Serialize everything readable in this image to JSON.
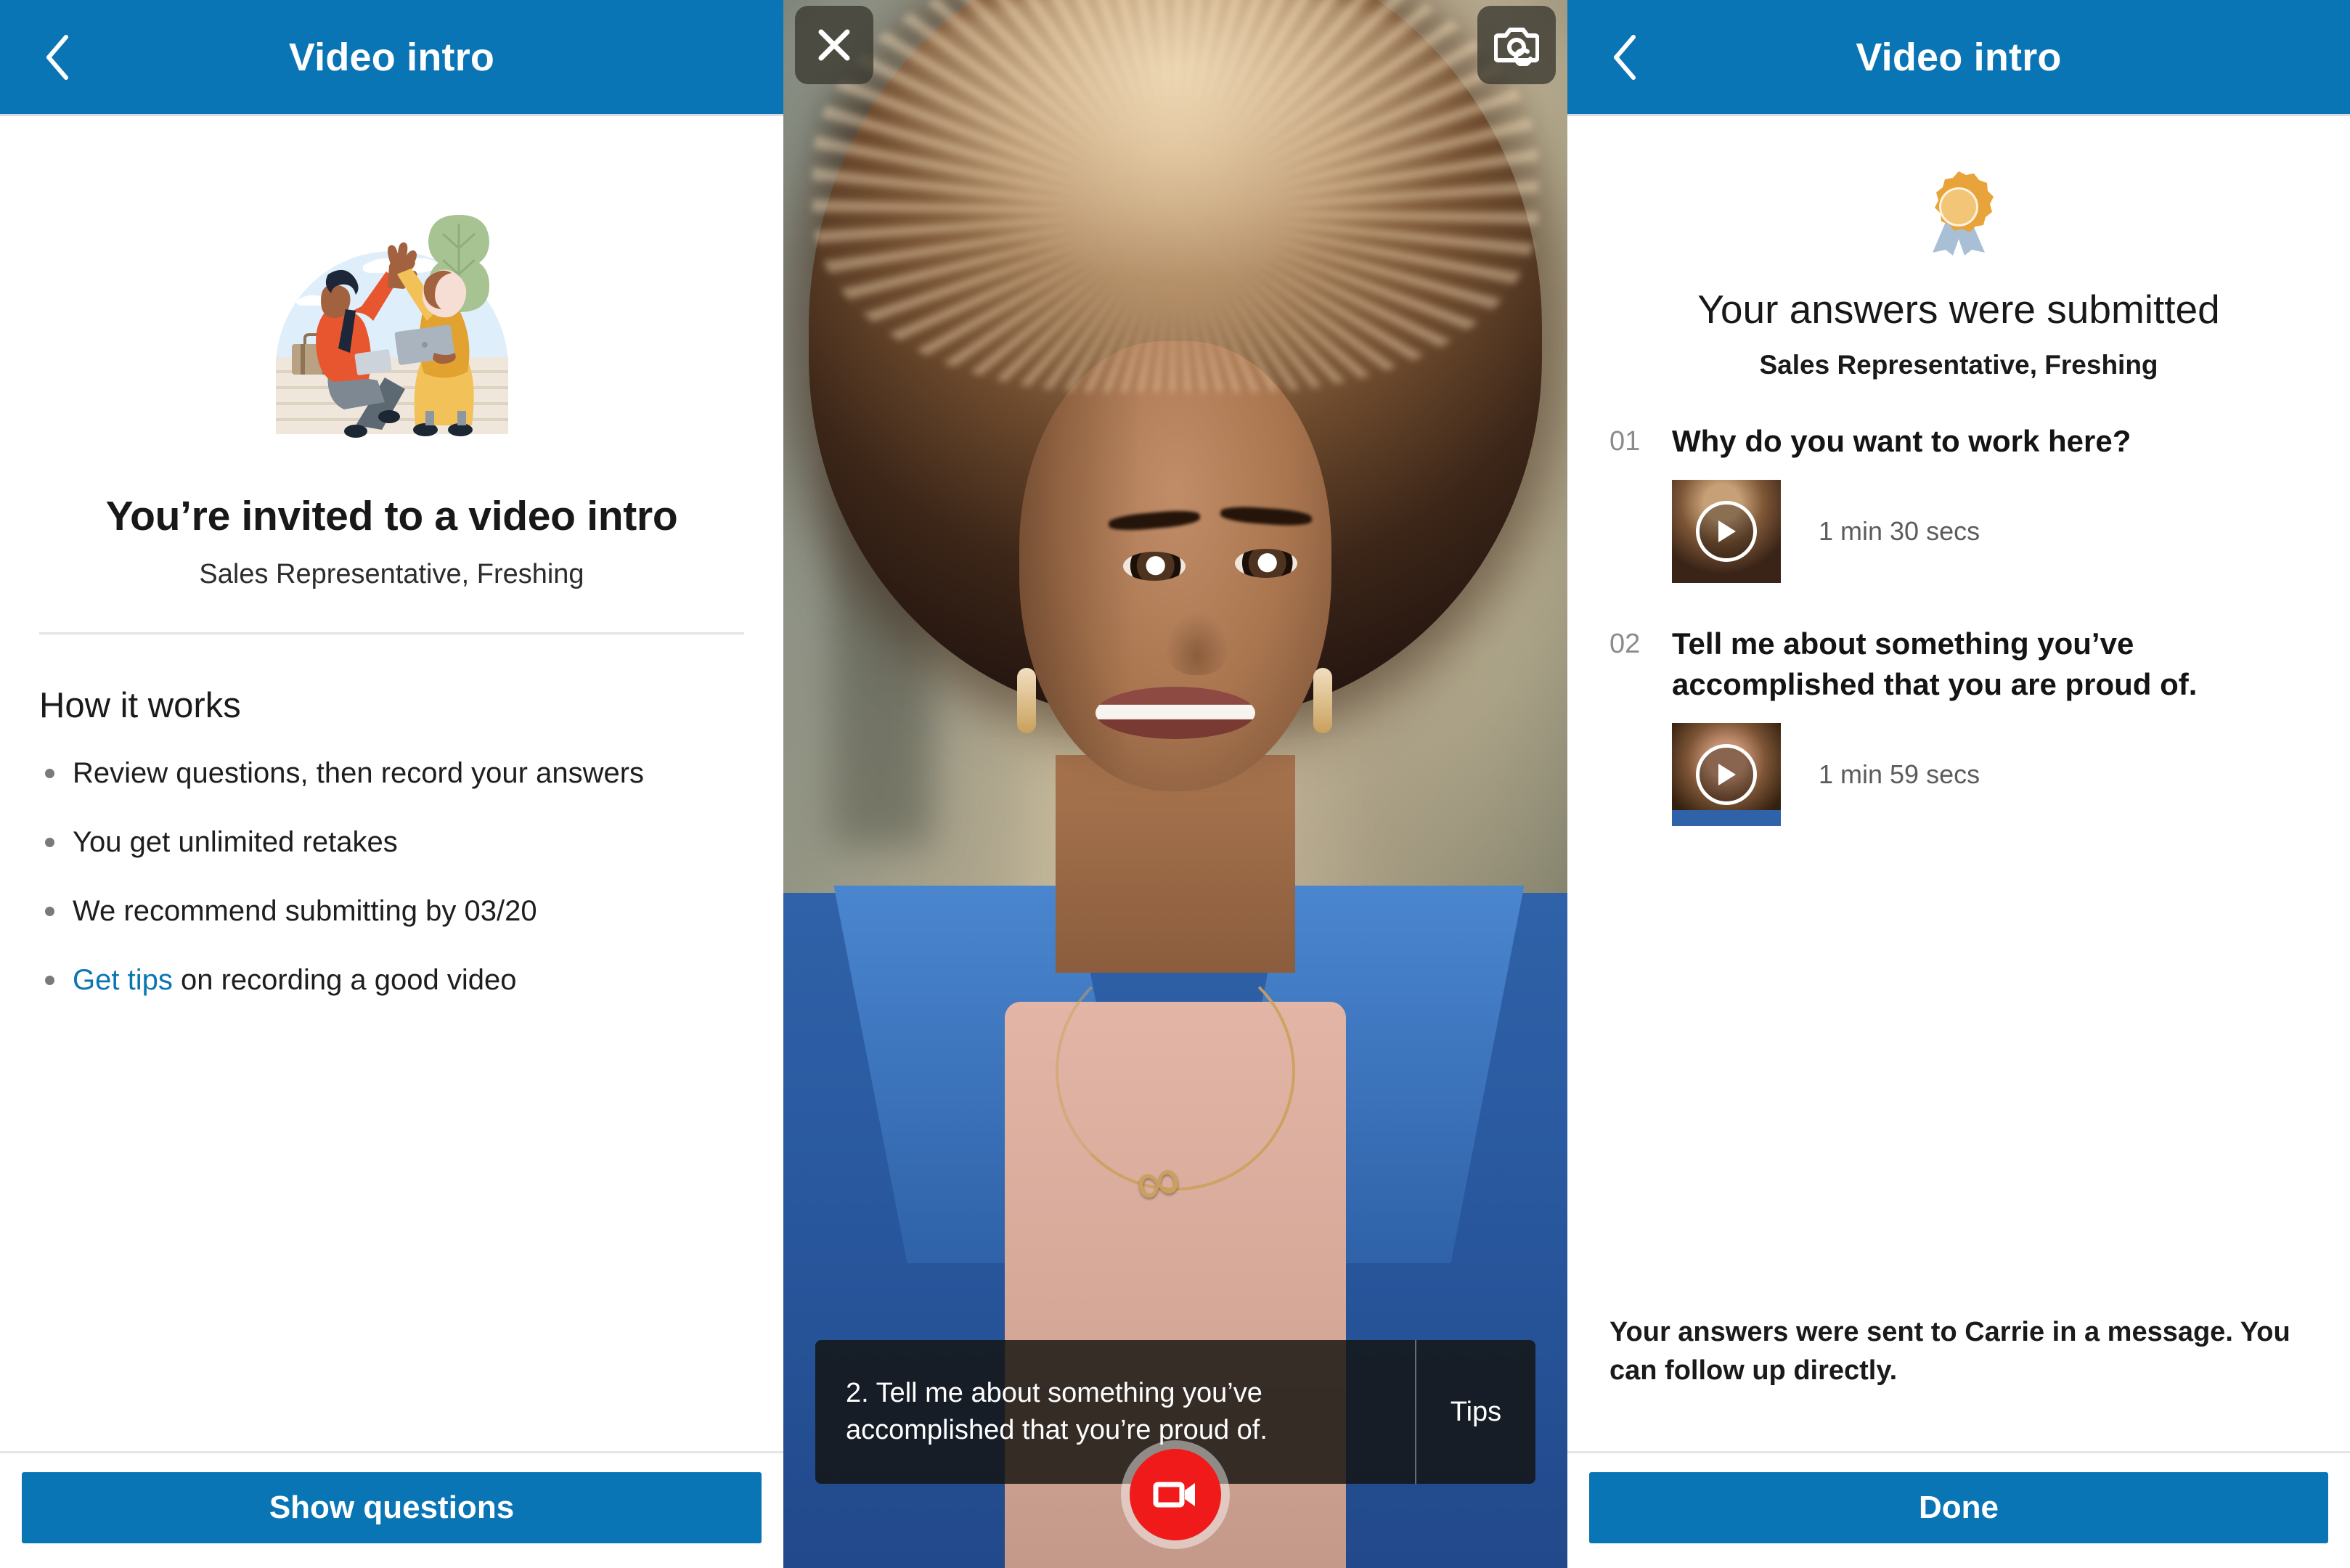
{
  "panel_invite": {
    "navbar": {
      "title": "Video intro",
      "back_icon": "chevron-left-icon"
    },
    "illustration_name": "high-five-illustration",
    "heading": "You’re invited to a video intro",
    "subheading": "Sales Representative, Freshing",
    "how_it_works_heading": "How it works",
    "bullets": [
      {
        "text": "Review questions, then record your answers"
      },
      {
        "text": "You get unlimited retakes"
      },
      {
        "text": "We recommend submitting by 03/20"
      },
      {
        "link": "Get tips",
        "text": " on recording a good video"
      }
    ],
    "primary_button": "Show questions"
  },
  "panel_record": {
    "close_icon": "close-icon",
    "flip_camera_icon": "camera-flip-icon",
    "question_prompt": "2. Tell me about something you’ve accomplished that you’re proud of.",
    "tips_label": "Tips",
    "record_icon": "video-camera-icon"
  },
  "panel_submitted": {
    "navbar": {
      "title": "Video intro",
      "back_icon": "chevron-left-icon"
    },
    "badge_icon": "award-ribbon-icon",
    "heading": "Your answers were submitted",
    "subheading": "Sales Representative, Freshing",
    "questions": [
      {
        "number": "01",
        "text": "Why do you want to work here?",
        "duration": "1 min 30 secs",
        "play_icon": "play-icon"
      },
      {
        "number": "02",
        "text": "Tell me about something you’ve accomplished that you are proud of.",
        "duration": "1 min 59 secs",
        "play_icon": "play-icon"
      }
    ],
    "note": "Your answers were sent to Carrie in a message. You can follow up directly.",
    "primary_button": "Done"
  },
  "colors": {
    "brand_blue": "#0a75b5",
    "record_red": "#f01a1a",
    "badge_gold": "#e8a33a",
    "link_blue": "#0a75b5",
    "muted_text": "#5c5c5c"
  }
}
